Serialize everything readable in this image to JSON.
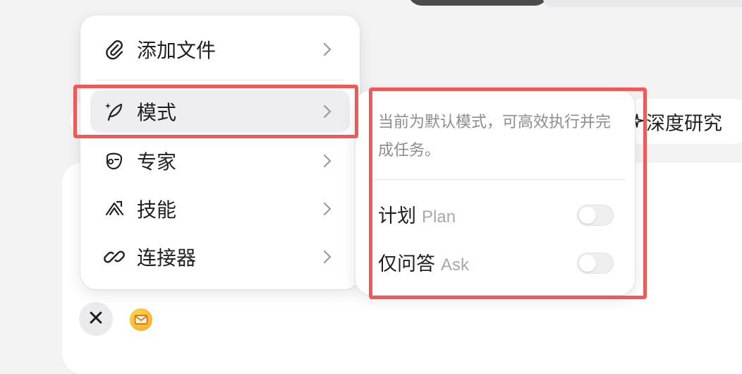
{
  "background_controls": {
    "deep_research_label": "深度研究",
    "close_symbol": "✕",
    "mail_icon": "mail-icon"
  },
  "menu": {
    "items": [
      {
        "label": "添加文件",
        "icon": "paperclip-icon"
      },
      {
        "label": "模式",
        "icon": "feather-sparkle-icon",
        "active": true
      },
      {
        "label": "专家",
        "icon": "expert-face-icon"
      },
      {
        "label": "技能",
        "icon": "skills-icon"
      },
      {
        "label": "连接器",
        "icon": "link-icon"
      }
    ]
  },
  "submenu": {
    "description": "当前为默认模式，可高效执行并完成任务。",
    "options": [
      {
        "label": "计划",
        "sublabel": "Plan",
        "enabled": false
      },
      {
        "label": "仅问答",
        "sublabel": "Ask",
        "enabled": false
      }
    ]
  },
  "colors": {
    "highlight": "#ee5a5a",
    "active_item_bg": "#eeeef0",
    "muted_text": "#8d8d8d"
  }
}
